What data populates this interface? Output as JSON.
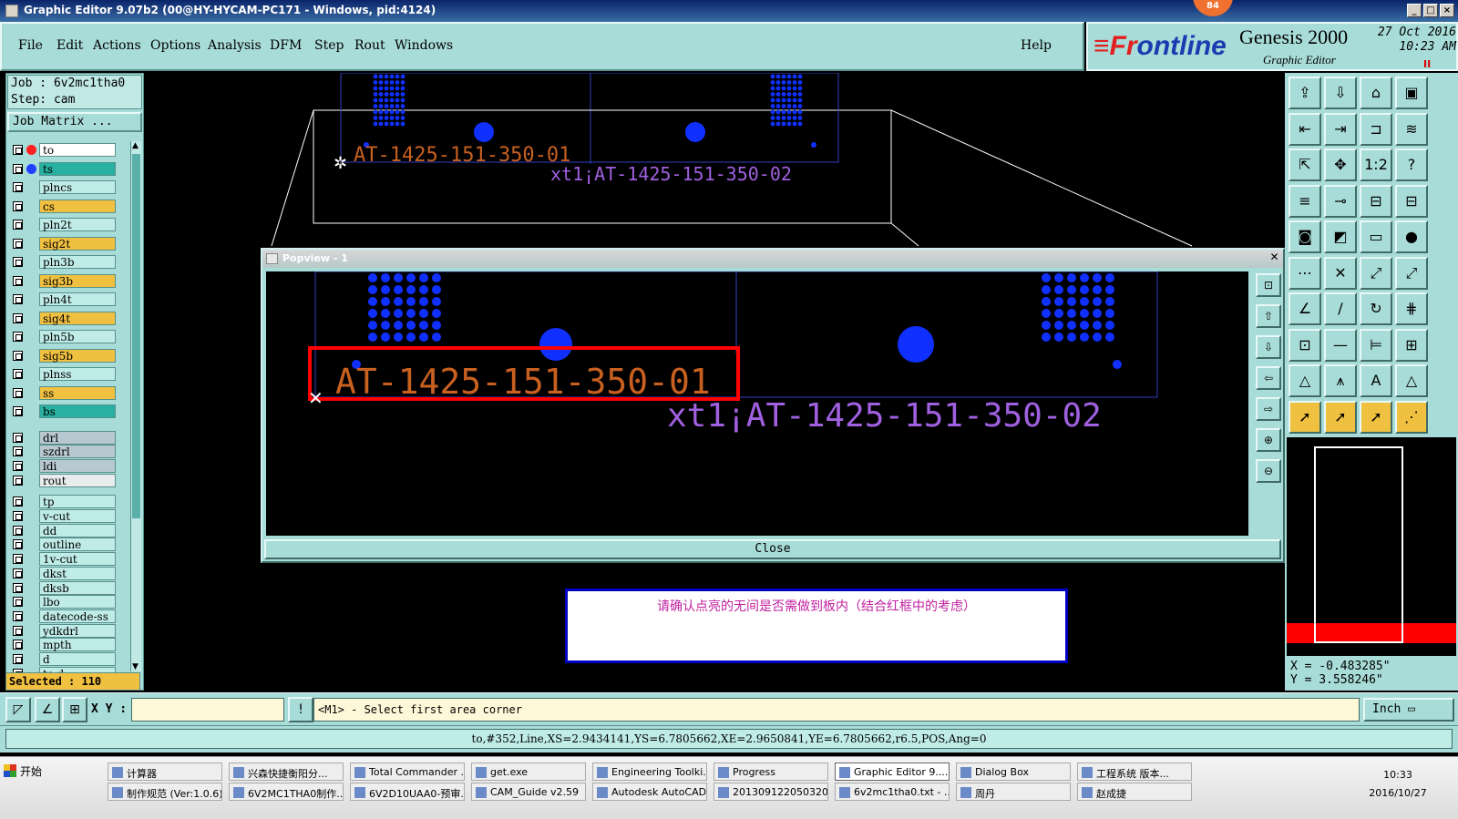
{
  "window": {
    "title": "Graphic Editor 9.07b2 (00@HY-HYCAM-PC171 - Windows, pid:4124)",
    "badge": "84"
  },
  "menu": {
    "items": [
      "File",
      "Edit",
      "Actions",
      "Options",
      "Analysis",
      "DFM",
      "Step",
      "Rout",
      "Windows"
    ],
    "help": "Help"
  },
  "brand": {
    "logo_front": "≡Fr",
    "logo_rest": "ntline",
    "logo_o": "o",
    "product": "Genesis 2000",
    "subtitle": "Graphic Editor",
    "date": "27 Oct 2016",
    "time": "10:23 AM",
    "pause": "II"
  },
  "job": {
    "job_line": "Job : 6v2mc1tha0",
    "step_line": "Step: cam",
    "matrix_button": "Job Matrix ..."
  },
  "layers": [
    {
      "name": "to",
      "color": "#ffffff",
      "dot": "#ff2020"
    },
    {
      "name": "ts",
      "color": "#28b0a0",
      "dot": "#2040ff"
    },
    {
      "name": "plncs",
      "color": "#c0ece8"
    },
    {
      "name": "cs",
      "color": "#f0c040"
    },
    {
      "name": "pln2t",
      "color": "#c0ece8"
    },
    {
      "name": "sig2t",
      "color": "#f0c040"
    },
    {
      "name": "pln3b",
      "color": "#c0ece8"
    },
    {
      "name": "sig3b",
      "color": "#f0c040"
    },
    {
      "name": "pln4t",
      "color": "#c0ece8"
    },
    {
      "name": "sig4t",
      "color": "#f0c040"
    },
    {
      "name": "pln5b",
      "color": "#c0ece8"
    },
    {
      "name": "sig5b",
      "color": "#f0c040"
    },
    {
      "name": "plnss",
      "color": "#c0ece8"
    },
    {
      "name": "ss",
      "color": "#f0c040"
    },
    {
      "name": "bs",
      "color": "#28b0a0"
    },
    {
      "name": "drl",
      "color": "#b8c8d0"
    },
    {
      "name": "szdrl",
      "color": "#b8c8d0"
    },
    {
      "name": "ldi",
      "color": "#b8c8d0"
    },
    {
      "name": "rout",
      "color": "#e8ecec"
    },
    {
      "name": "tp",
      "color": "#c0ece8"
    },
    {
      "name": "v-cut",
      "color": "#c0ece8"
    },
    {
      "name": "dd",
      "color": "#c0ece8"
    },
    {
      "name": "outline",
      "color": "#c0ece8"
    },
    {
      "name": "1v-cut",
      "color": "#c0ece8"
    },
    {
      "name": "dkst",
      "color": "#c0ece8"
    },
    {
      "name": "dksb",
      "color": "#c0ece8"
    },
    {
      "name": "lbo",
      "color": "#c0ece8"
    },
    {
      "name": "datecode-ss",
      "color": "#c0ece8"
    },
    {
      "name": "ydkdrl",
      "color": "#c0ece8"
    },
    {
      "name": "mpth",
      "color": "#c0ece8"
    },
    {
      "name": "d",
      "color": "#c0ece8"
    },
    {
      "name": "to.d",
      "color": "#c0ece8"
    }
  ],
  "selected": "Selected : 110",
  "graphics": {
    "text_01": "AT-1425-151-350-01",
    "text_02": "xt1¡AT-1425-151-350-02",
    "pad_color": "#1030ff",
    "text1_color": "#c86020",
    "text2_color": "#a060e0",
    "outline_color": "#ffffff"
  },
  "popview": {
    "title": "Popview - 1",
    "close_button": "Close"
  },
  "message": "请确认点亮的无间是否需做到板内（结合红框中的考虑）",
  "toolbar_labels": [
    "1:2",
    "?"
  ],
  "coords": {
    "x": "X = -0.483285\"",
    "y": "Y = 3.558246\""
  },
  "command": {
    "xy_label": "X Y :",
    "xy_value": "",
    "prompt": "<M1> - Select first area corner",
    "units": "Inch ▭"
  },
  "status": "to,#352,Line,XS=2.9434141,YS=6.7805662,XE=2.9650841,YE=6.7805662,r6.5,POS,Ang=0",
  "taskbar": {
    "start": "开始",
    "row1": [
      "计算器",
      "兴森快捷衡阳分...",
      "Total Commander ...",
      "get.exe",
      "Engineering Toolki...",
      "Progress",
      "Graphic Editor 9....",
      "Dialog Box",
      "工程系统  版本..."
    ],
    "row2": [
      "制作规范 (Ver:1.0.6)",
      "6V2MC1THA0制作...",
      "6V2D10UAA0-预审...",
      "CAM_Guide v2.59",
      "Autodesk AutoCAD...",
      "201309122050320...",
      "6v2mc1tha0.txt - ...",
      "周丹",
      "赵成捷"
    ],
    "clock_time": "10:33",
    "clock_date": "2016/10/27"
  }
}
